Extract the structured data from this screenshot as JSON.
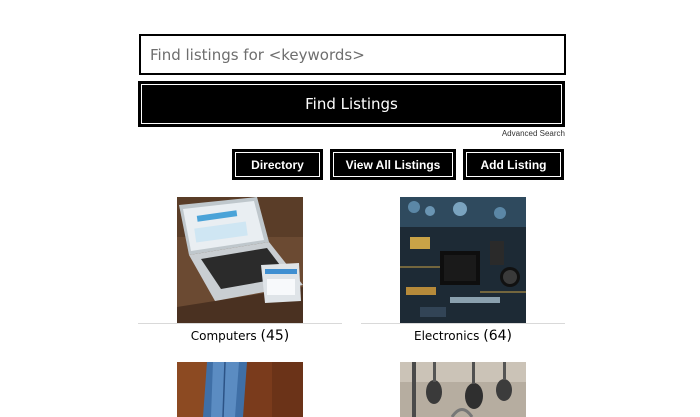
{
  "search": {
    "placeholder": "Find listings for <keywords>",
    "value": "",
    "button_label": "Find Listings",
    "advanced_label": "Advanced Search"
  },
  "nav": {
    "directory": "Directory",
    "view_all": "View All Listings",
    "add_listing": "Add Listing"
  },
  "categories": [
    {
      "name": "Computers",
      "count": "(45)",
      "image": "laptop-photo"
    },
    {
      "name": "Electronics",
      "count": "(64)",
      "image": "circuit-board-photo"
    },
    {
      "name": "",
      "count": "",
      "image": "jeans-photo"
    },
    {
      "name": "",
      "count": "",
      "image": "kitchen-utensils-photo"
    }
  ]
}
